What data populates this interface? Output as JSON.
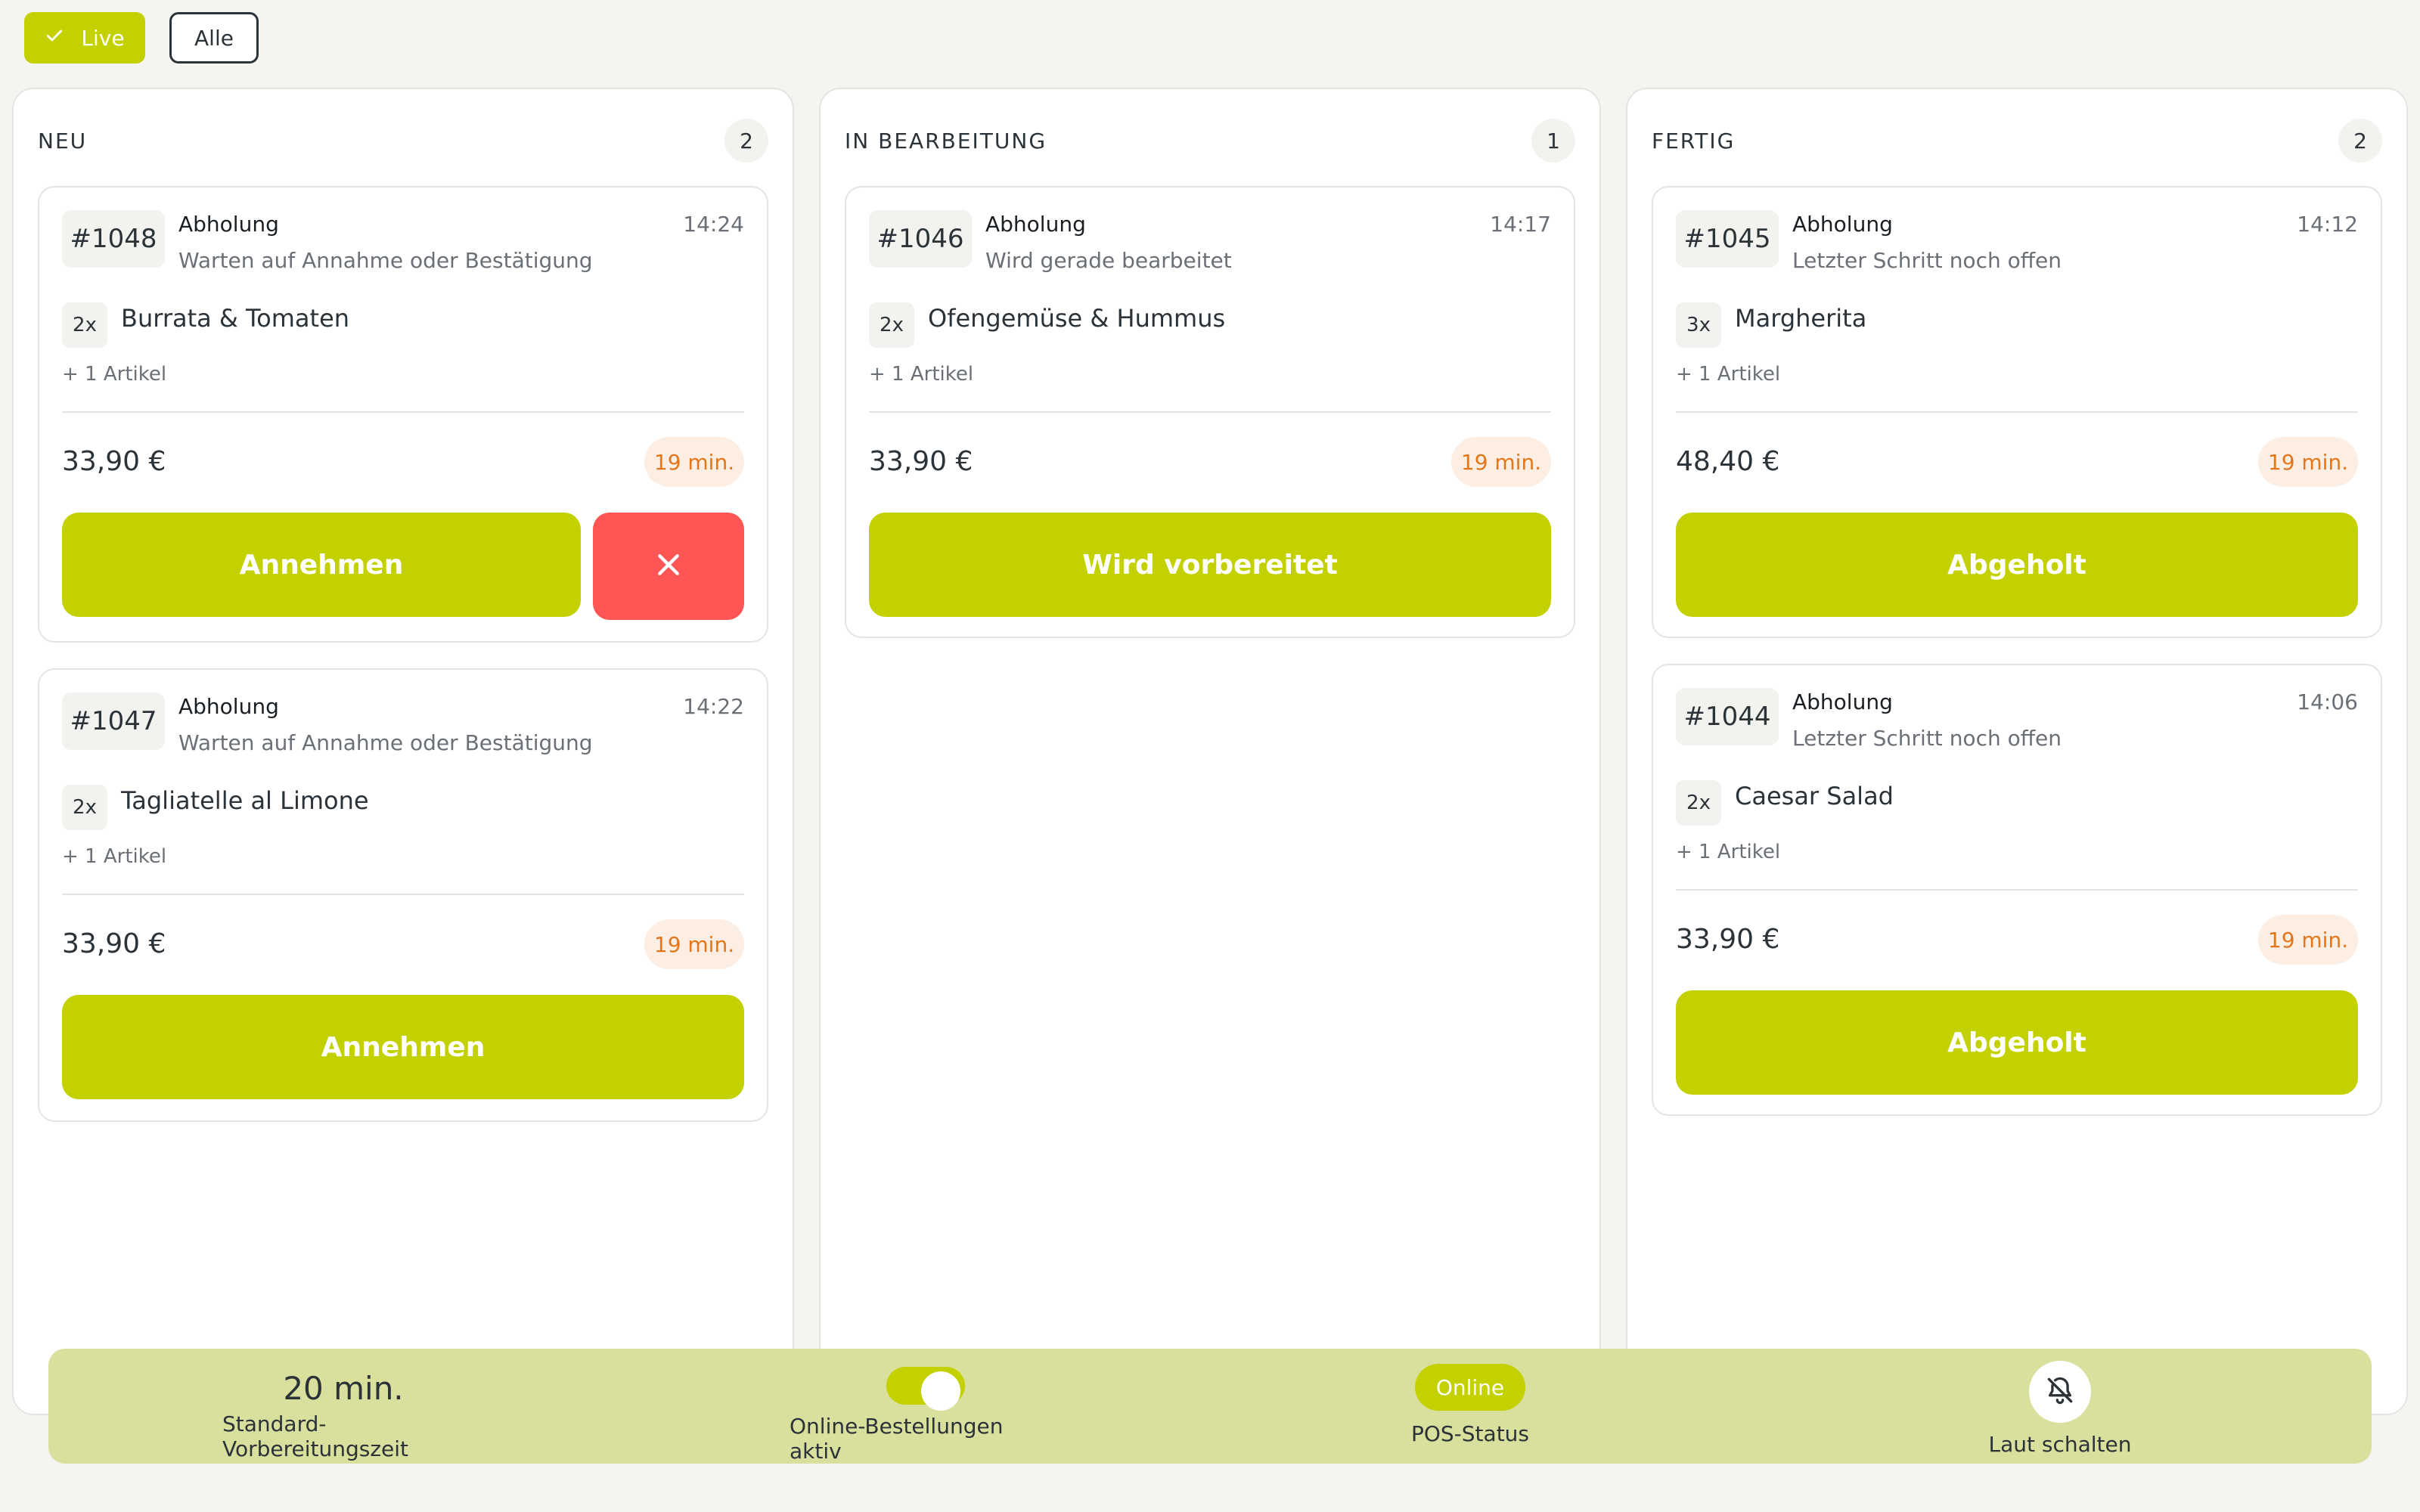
{
  "filters": {
    "live_label": "Live",
    "all_label": "Alle"
  },
  "columns": [
    {
      "title": "NEU",
      "count": "2",
      "cards": [
        {
          "order": "#1048",
          "type": "Abholung",
          "status": "Warten auf Annahme oder Bestätigung",
          "time": "14:24",
          "qty": "2x",
          "item": "Burrata & Tomaten",
          "more": "+ 1 Artikel",
          "price": "33,90 €",
          "eta": "19 min.",
          "action": "Annehmen"
        },
        {
          "order": "#1047",
          "type": "Abholung",
          "status": "Warten auf Annahme oder Bestätigung",
          "time": "14:22",
          "qty": "2x",
          "item": "Tagliatelle al Limone",
          "more": "+ 1 Artikel",
          "price": "33,90 €",
          "eta": "19 min.",
          "action": "Annehmen"
        }
      ]
    },
    {
      "title": "IN BEARBEITUNG",
      "count": "1",
      "cards": [
        {
          "order": "#1046",
          "type": "Abholung",
          "status": "Wird gerade bearbeitet",
          "time": "14:17",
          "qty": "2x",
          "item": "Ofengemüse & Hummus",
          "more": "+ 1 Artikel",
          "price": "33,90 €",
          "eta": "19 min.",
          "action": "Wird vorbereitet"
        }
      ]
    },
    {
      "title": "FERTIG",
      "count": "2",
      "cards": [
        {
          "order": "#1045",
          "type": "Abholung",
          "status": "Letzter Schritt noch offen",
          "time": "14:12",
          "qty": "3x",
          "item": "Margherita",
          "more": "+ 1 Artikel",
          "price": "48,40 €",
          "eta": "19 min.",
          "action": "Abgeholt"
        },
        {
          "order": "#1044",
          "type": "Abholung",
          "status": "Letzter Schritt noch offen",
          "time": "14:06",
          "qty": "2x",
          "item": "Caesar Salad",
          "more": "+ 1 Artikel",
          "price": "33,90 €",
          "eta": "19 min.",
          "action": "Abgeholt"
        }
      ]
    }
  ],
  "footer": {
    "prep_time_value": "20 min.",
    "prep_time_label": "Standard-Vorbereitungszeit",
    "online_orders_label": "Online-Bestellungen aktiv",
    "online_orders_enabled": true,
    "pos_status_value": "Online",
    "pos_status_label": "POS-Status",
    "mute_label": "Laut schalten"
  },
  "colors": {
    "accent": "#c3d100",
    "reject": "#ff5555",
    "eta_text": "#e2761b",
    "eta_bg": "#fdeee4",
    "footer_bg": "#d9df9d"
  },
  "icons": {
    "live": "check-icon",
    "reject": "close-icon",
    "mute": "bell-off-icon"
  }
}
